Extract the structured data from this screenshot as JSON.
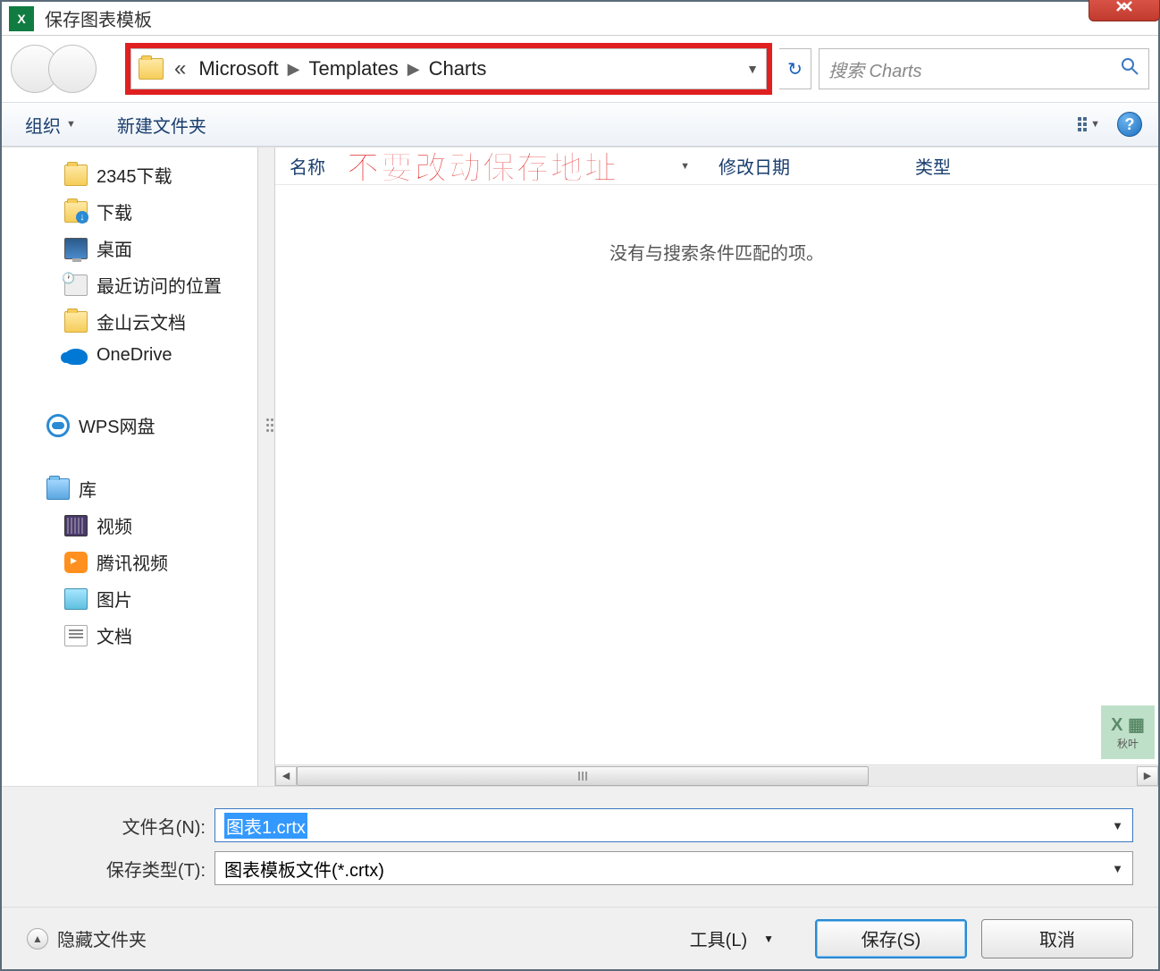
{
  "title": "保存图表模板",
  "close_icon": "close",
  "breadcrumb": {
    "overflow": "«",
    "segments": [
      "Microsoft",
      "Templates",
      "Charts"
    ]
  },
  "search": {
    "placeholder": "搜索 Charts"
  },
  "toolbar": {
    "organize": "组织",
    "new_folder": "新建文件夹"
  },
  "annotation": "不要改动保存地址",
  "columns": {
    "name": "名称",
    "modified": "修改日期",
    "type": "类型"
  },
  "empty_message": "没有与搜索条件匹配的项。",
  "tree": {
    "items": [
      {
        "label": "2345下载",
        "icon": "folder"
      },
      {
        "label": "下载",
        "icon": "folder-dl"
      },
      {
        "label": "桌面",
        "icon": "desktop"
      },
      {
        "label": "最近访问的位置",
        "icon": "recent"
      },
      {
        "label": "金山云文档",
        "icon": "folder"
      },
      {
        "label": "OneDrive",
        "icon": "onedrive"
      }
    ],
    "wps": {
      "label": "WPS网盘",
      "icon": "wpscloud"
    },
    "library": {
      "label": "库",
      "icon": "lib-main"
    },
    "lib_items": [
      {
        "label": "视频",
        "icon": "vid"
      },
      {
        "label": "腾讯视频",
        "icon": "tvid"
      },
      {
        "label": "图片",
        "icon": "pic"
      },
      {
        "label": "文档",
        "icon": "doc"
      }
    ]
  },
  "form": {
    "filename_label": "文件名(N):",
    "filename_value": "图表1.crtx",
    "filetype_label": "保存类型(T):",
    "filetype_value": "图表模板文件(*.crtx)"
  },
  "actions": {
    "hide_folders": "隐藏文件夹",
    "tools": "工具(L)",
    "save": "保存(S)",
    "cancel": "取消"
  },
  "watermark": "秋叶"
}
